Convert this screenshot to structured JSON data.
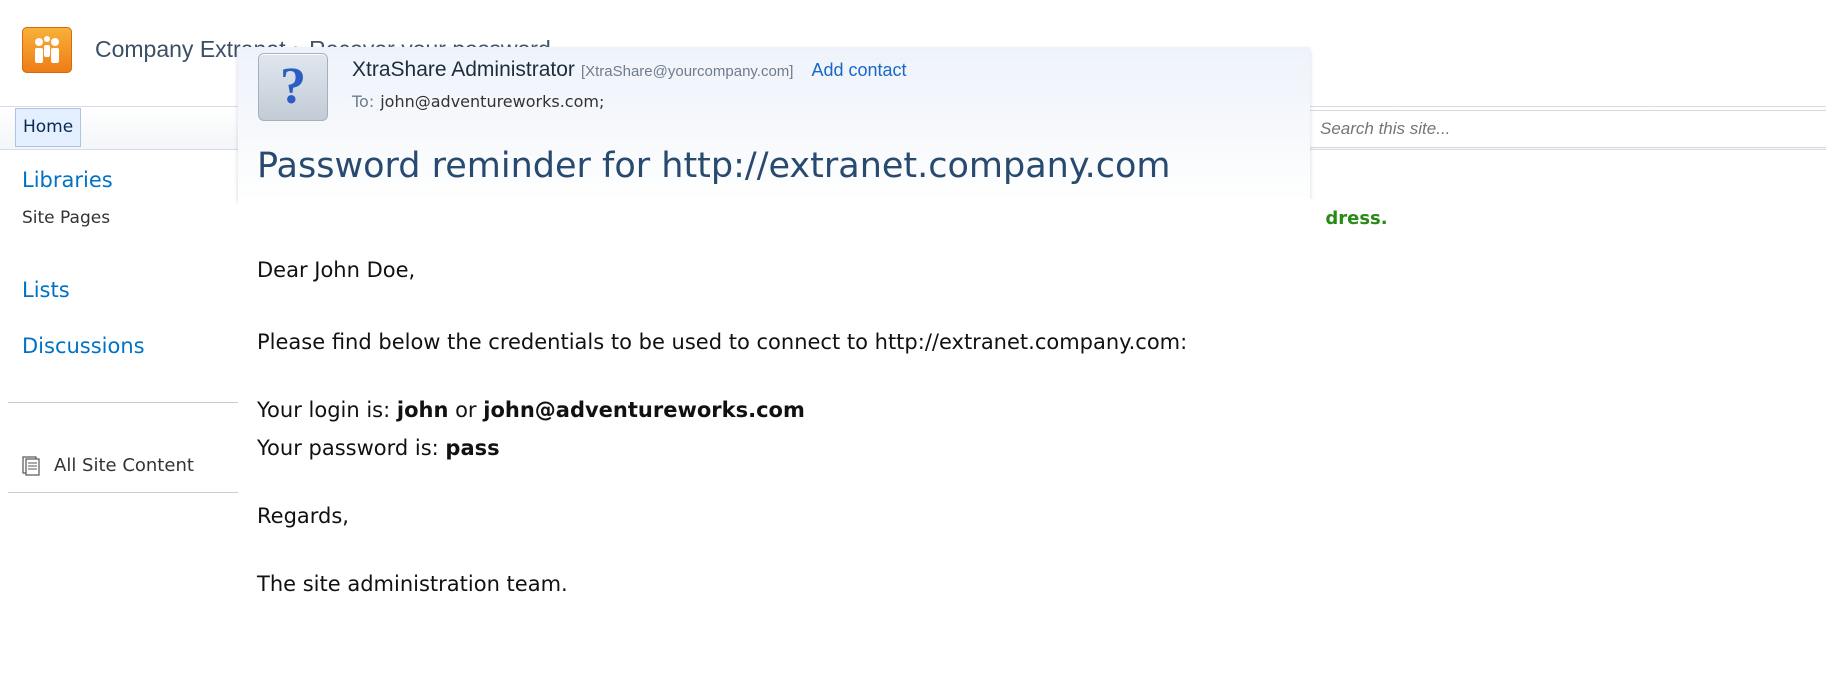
{
  "site": {
    "title": "Company Extranet",
    "separator": "›",
    "page": "Recover your password"
  },
  "topnav": {
    "home_label": "Home",
    "search_placeholder": "Search this site..."
  },
  "quicklaunch": {
    "libraries": "Libraries",
    "site_pages": "Site Pages",
    "lists": "Lists",
    "discussions": "Discussions",
    "all_site_content": "All Site Content"
  },
  "status_message": "Your password has been sent to the specified email address.",
  "email": {
    "sender_name": "XtraShare Administrator",
    "sender_email": "[XtraShare@yourcompany.com]",
    "add_contact": "Add contact",
    "to_label": "To:",
    "to_address": "john@adventureworks.com;",
    "subject": "Password reminder for http://extranet.company.com",
    "greeting": "Dear John Doe,",
    "intro": "Please find below the credentials to be used to connect to http://extranet.company.com:",
    "login_prefix": "Your login is: ",
    "login_user": "john",
    "login_or": " or ",
    "login_email": "john@adventureworks.com",
    "password_prefix": "Your password is: ",
    "password_value": "pass",
    "regards": "Regards,",
    "signature": "The site administration team."
  },
  "colors": {
    "link_blue": "#0072c6",
    "status_green": "#2a8a18",
    "subject_blue": "#284a6e"
  }
}
